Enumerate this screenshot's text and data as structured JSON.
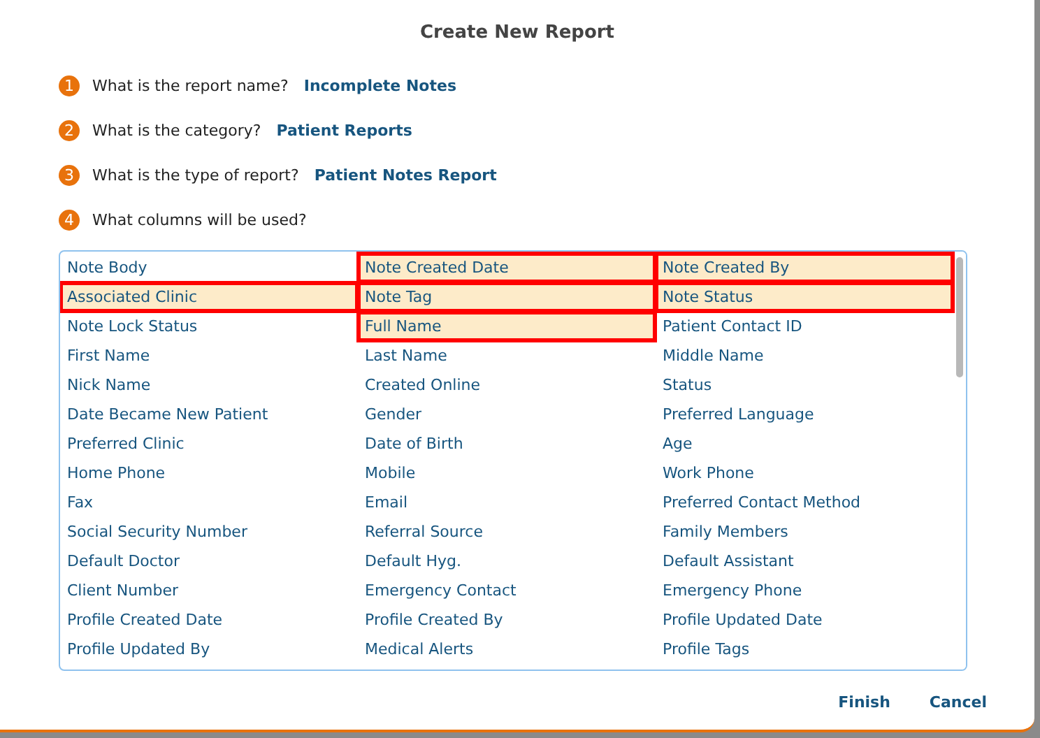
{
  "dialog": {
    "title": "Create New Report"
  },
  "steps": [
    {
      "number": "1",
      "question": "What is the report name?",
      "answer": "Incomplete Notes"
    },
    {
      "number": "2",
      "question": "What is the category?",
      "answer": "Patient Reports"
    },
    {
      "number": "3",
      "question": "What is the type of report?",
      "answer": "Patient Notes Report"
    },
    {
      "number": "4",
      "question": "What columns will be used?"
    }
  ],
  "columns": [
    {
      "label": "Note Body",
      "selected": false
    },
    {
      "label": "Note Created Date",
      "selected": true
    },
    {
      "label": "Note Created By",
      "selected": true
    },
    {
      "label": "Associated Clinic",
      "selected": true
    },
    {
      "label": "Note Tag",
      "selected": true
    },
    {
      "label": "Note Status",
      "selected": true
    },
    {
      "label": "Note Lock Status",
      "selected": false
    },
    {
      "label": "Full Name",
      "selected": true
    },
    {
      "label": "Patient Contact ID",
      "selected": false
    },
    {
      "label": "First Name",
      "selected": false
    },
    {
      "label": "Last Name",
      "selected": false
    },
    {
      "label": "Middle Name",
      "selected": false
    },
    {
      "label": "Nick Name",
      "selected": false
    },
    {
      "label": "Created Online",
      "selected": false
    },
    {
      "label": "Status",
      "selected": false
    },
    {
      "label": "Date Became New Patient",
      "selected": false
    },
    {
      "label": "Gender",
      "selected": false
    },
    {
      "label": "Preferred Language",
      "selected": false
    },
    {
      "label": "Preferred Clinic",
      "selected": false
    },
    {
      "label": "Date of Birth",
      "selected": false
    },
    {
      "label": "Age",
      "selected": false
    },
    {
      "label": "Home Phone",
      "selected": false
    },
    {
      "label": "Mobile",
      "selected": false
    },
    {
      "label": "Work Phone",
      "selected": false
    },
    {
      "label": "Fax",
      "selected": false
    },
    {
      "label": "Email",
      "selected": false
    },
    {
      "label": "Preferred Contact Method",
      "selected": false
    },
    {
      "label": "Social Security Number",
      "selected": false
    },
    {
      "label": "Referral Source",
      "selected": false
    },
    {
      "label": "Family Members",
      "selected": false
    },
    {
      "label": "Default Doctor",
      "selected": false
    },
    {
      "label": "Default Hyg.",
      "selected": false
    },
    {
      "label": "Default Assistant",
      "selected": false
    },
    {
      "label": "Client Number",
      "selected": false
    },
    {
      "label": "Emergency Contact",
      "selected": false
    },
    {
      "label": "Emergency Phone",
      "selected": false
    },
    {
      "label": "Profile Created Date",
      "selected": false
    },
    {
      "label": "Profile Created By",
      "selected": false
    },
    {
      "label": "Profile Updated Date",
      "selected": false
    },
    {
      "label": "Profile Updated By",
      "selected": false
    },
    {
      "label": "Medical Alerts",
      "selected": false
    },
    {
      "label": "Profile Tags",
      "selected": false
    }
  ],
  "buttons": [
    "Finish",
    "Cancel"
  ]
}
